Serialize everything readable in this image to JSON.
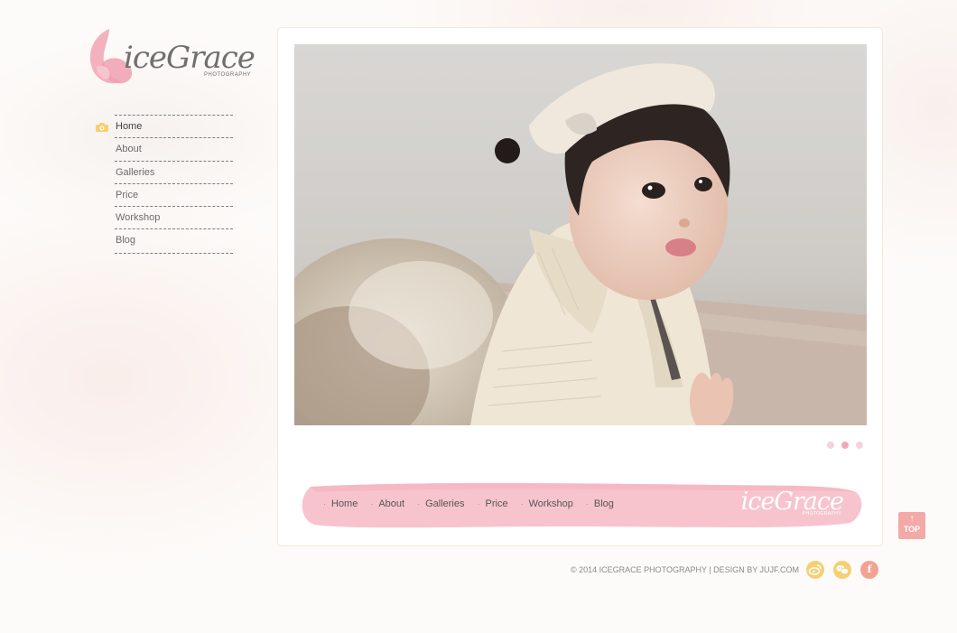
{
  "logo": {
    "text": "iceGrace",
    "subtitle": "PHOTOGRAPHY"
  },
  "sidebar": {
    "items": [
      {
        "label": "Home",
        "active": true
      },
      {
        "label": "About"
      },
      {
        "label": "Galleries"
      },
      {
        "label": "Price"
      },
      {
        "label": "Workshop"
      },
      {
        "label": "Blog"
      }
    ],
    "active_icon": "camera-icon"
  },
  "slider": {
    "image": "photo of a toddler in a cream knit cardigan and headband",
    "slide_count": 3,
    "active_slide": 2
  },
  "footer_band": {
    "nav": [
      {
        "label": "Home"
      },
      {
        "label": "About"
      },
      {
        "label": "Galleries"
      },
      {
        "label": "Price"
      },
      {
        "label": "Workshop"
      },
      {
        "label": "Blog"
      }
    ],
    "logo_text": "iceGrace",
    "logo_subtitle": "PHOTOGRAPHY"
  },
  "top_button": {
    "label": "TOP",
    "icon": "arrow-up-icon"
  },
  "copyright": "© 2014 ICEGRACE PHOTOGRAPHY | DESIGN BY JUJF.COM",
  "social": [
    {
      "name": "weibo-icon",
      "color": "#f6cf74"
    },
    {
      "name": "wechat-icon",
      "color": "#f6cf74"
    },
    {
      "name": "facebook-icon",
      "color": "#f2a293",
      "glyph": "f"
    }
  ],
  "colors": {
    "brand_pink": "#f4b8c6",
    "band_pink": "#f7c6cf",
    "text_gray": "#6b6b6b"
  }
}
